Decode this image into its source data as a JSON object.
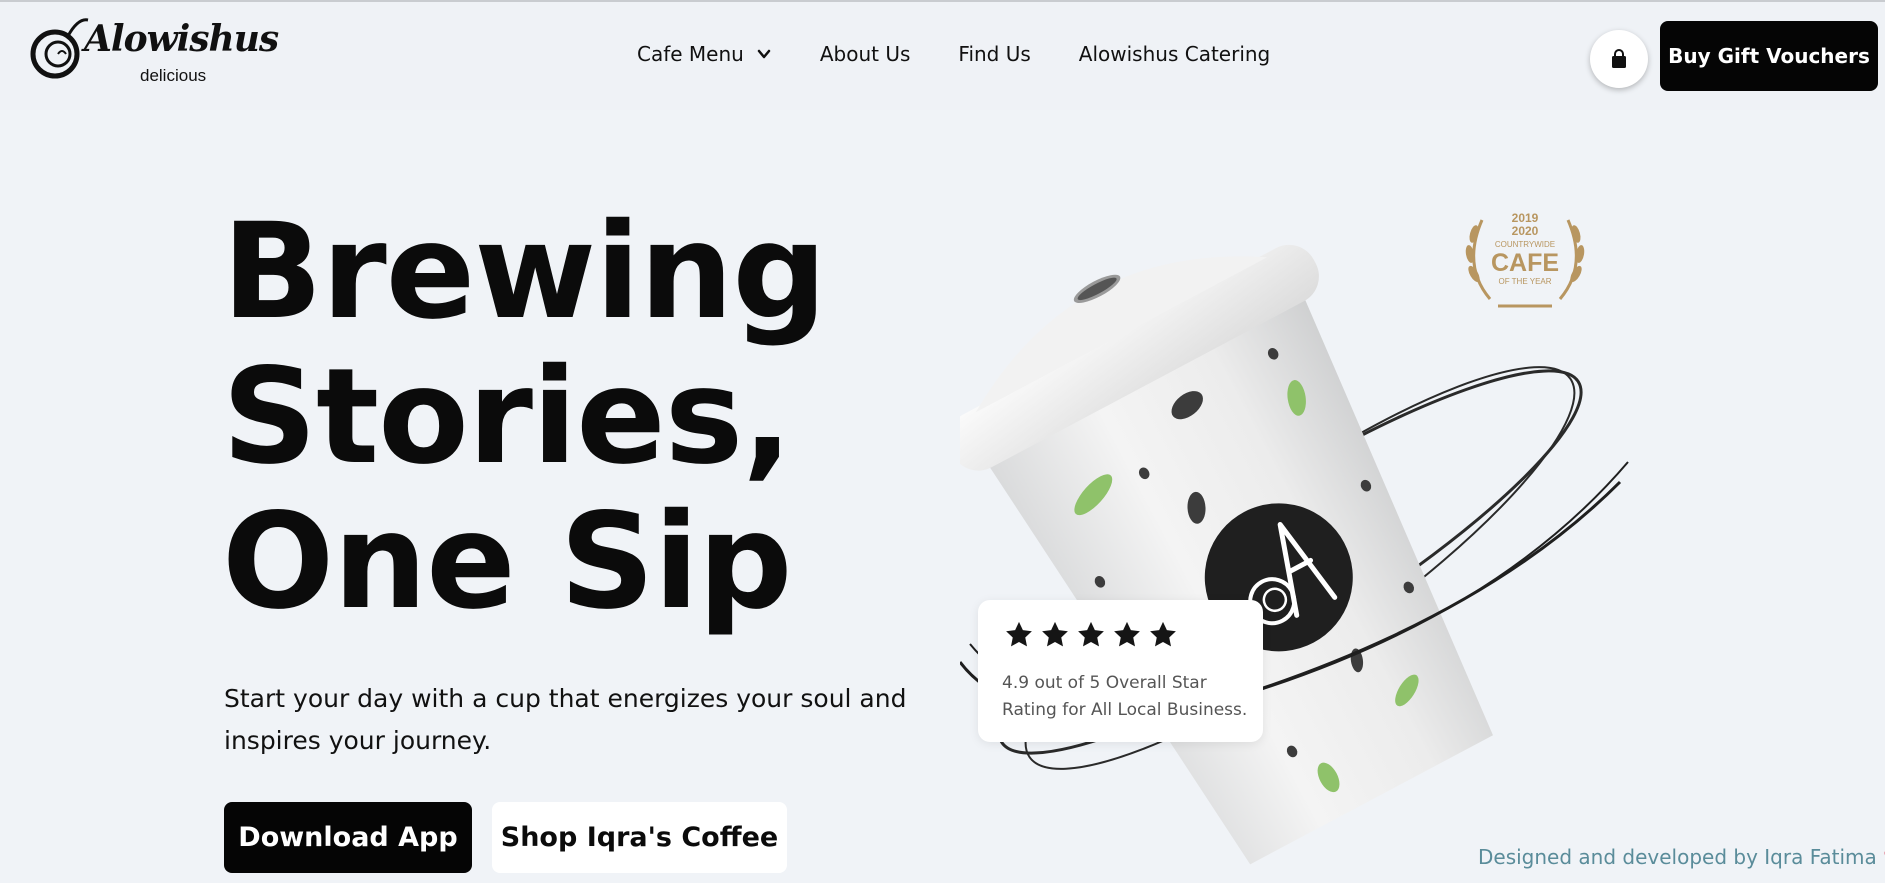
{
  "header": {
    "logo": {
      "brand": "Alowishus",
      "tagline": "delicious",
      "icon": "brand-logo-mark"
    },
    "nav": [
      {
        "label": "Cafe Menu",
        "icon": "chevron-down-icon"
      },
      {
        "label": "About Us"
      },
      {
        "label": "Find Us"
      },
      {
        "label": "Alowishus Catering"
      }
    ],
    "cart_icon": "shopping-bag-icon",
    "gift_button": "Buy Gift Vouchers"
  },
  "hero": {
    "title_lines": [
      "Brewing",
      "Stories,",
      "One Sip"
    ],
    "subtitle_lines": [
      "Start your day with a cup that energizes your soul and",
      "inspires your journey."
    ],
    "buttons": {
      "primary": "Download App",
      "secondary": "Shop Iqra's Coffee"
    }
  },
  "rating": {
    "stars": 5,
    "max_stars": 5,
    "text_lines": [
      "4.9 out of 5 Overall Star",
      "Rating for All Local Business."
    ]
  },
  "award": {
    "years": [
      "2019",
      "2020"
    ],
    "line1": "COUNTRYWIDE",
    "line2": "CAFE",
    "line3": "OF THE YEAR"
  },
  "credit": {
    "text": "Designed and developed by Iqra Fatima",
    "icon": "heart-icon"
  },
  "colors": {
    "background": "#f0f3f7",
    "dark": "#050505",
    "credit_text": "#5a8c9a",
    "heart": "#d9415a",
    "award_gold": "#b89660",
    "leaf_green": "#8fc26a"
  }
}
